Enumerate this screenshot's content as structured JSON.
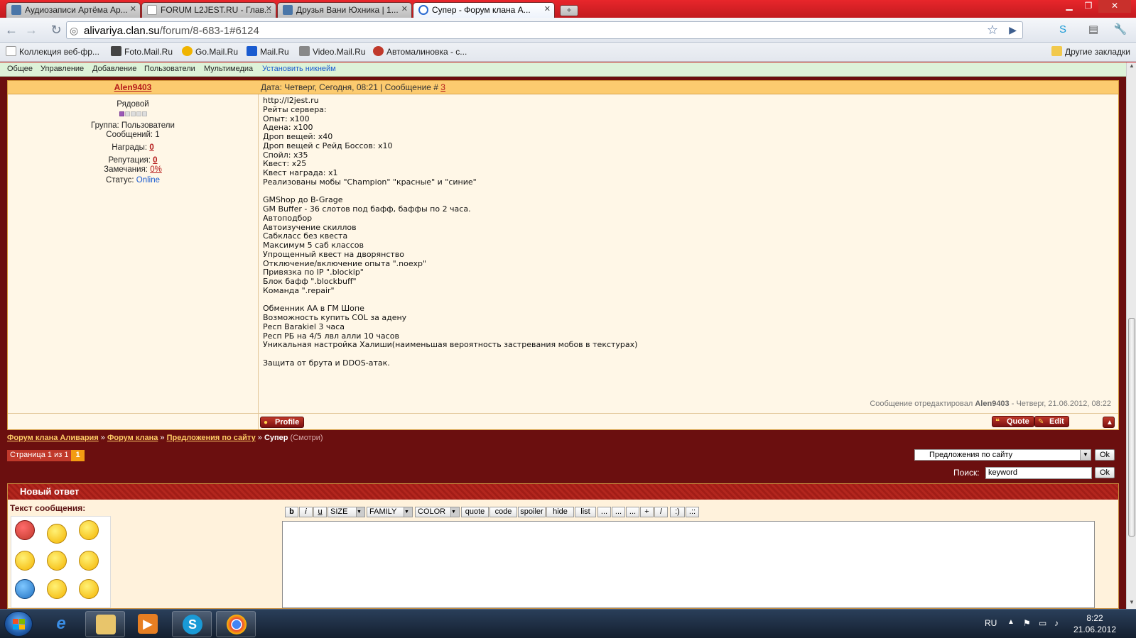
{
  "browser": {
    "tabs": [
      {
        "title": "Аудиозаписи Артёма Ар...",
        "icon": "vk-icon"
      },
      {
        "title": "FORUM L2JEST.RU - Глав...",
        "icon": "page-icon"
      },
      {
        "title": "Друзья Вани Юхника | 1...",
        "icon": "vk-icon"
      },
      {
        "title": "Супер - Форум клана А...",
        "icon": "forum-icon"
      }
    ],
    "url_host": "alivariya.clan.su",
    "url_path": "/forum/8-683-1#6124",
    "bookmarks": [
      {
        "label": "Коллекция веб-фр...",
        "icon": "page-icon"
      },
      {
        "label": "Foto.Mail.Ru",
        "icon": "camera-icon"
      },
      {
        "label": "Go.Mail.Ru",
        "icon": "search-icon"
      },
      {
        "label": "Mail.Ru",
        "icon": "mail-icon"
      },
      {
        "label": "Video.Mail.Ru",
        "icon": "video-icon"
      },
      {
        "label": "Автомалиновка - с...",
        "icon": "car-icon"
      }
    ],
    "other_bookmarks": "Другие закладки"
  },
  "adminbar": {
    "items": [
      "Общее",
      "Управление",
      "Добавление",
      "Пользователи",
      "Мультимедиа"
    ],
    "set_nick": "Установить никнейм"
  },
  "post": {
    "author": "Alen9403",
    "date_prefix": "Дата: Четверг, Сегодня, 08:21 | Сообщение # ",
    "post_number": "3",
    "rank": "Рядовой",
    "group": "Группа: Пользователи",
    "messages": "Сообщений: 1",
    "awards_label": "Награды: ",
    "awards_value": "0",
    "reputation_label": "Репутация: ",
    "reputation_value": "0",
    "warnings_label": "Замечания: ",
    "warnings_value": "0%",
    "status_label": "Статус: ",
    "status_value": "Online",
    "body": "http://l2jest.ru\nРейты сервера:\nОпыт: x100\nАдена: x100\nДроп вещей: x40\nДроп вещей с Рейд Боссов: x10\nСпойл: x35\nКвест: x25\nКвест награда: x1\nРеализованы мобы \"Champion\" \"красные\" и \"синие\"\n\nGMShop до B-Grage\nGM Buffer - 36 слотов под бафф, баффы по 2 часа.\nАвтоподбор\nАвтоизучение скиллов\nСабкласс без квеста\nМаксимум 5 саб классов\nУпрощенный квест на дворянство\nОтключение/включение опыта \".noexp\"\nПривязка по IP \".blockip\"\nБлок бафф \".blockbuff\"\nКоманда \".repair\"\n\nОбменник АА в ГМ Шопе\nВозможность купить COL за адену\nРесп Barakiel 3 часа\nРесп РБ на 4/5 лвл алли 10 часов\nУникальная настройка Халиши(наименьшая вероятность застревания мобов в текстурах)\n\nЗащита от брута и DDOS-атак.",
    "edited_prefix": "Сообщение отредактировал ",
    "edited_user": "Alen9403",
    "edited_suffix": " - Четверг, 21.06.2012, 08:22",
    "profile_btn": "Profile",
    "quote_btn": "Quote",
    "edit_btn": "Edit"
  },
  "breadcrumb": {
    "items": [
      "Форум клана Аливария",
      "Форум клана",
      "Предложения по сайту"
    ],
    "sep": " » ",
    "current": "Супер",
    "current_sub": " (Смотри)"
  },
  "pager": {
    "label": "Страница 1 из 1",
    "current": "1"
  },
  "jump": {
    "selected": "Предложения по сайту",
    "ok": "Ok"
  },
  "search": {
    "label": "Поиск:",
    "value": "keyword",
    "ok": "Ok"
  },
  "reply": {
    "title": "Новый ответ",
    "text_label": "Текст сообщения:",
    "toolbar": [
      "b",
      "i",
      "u",
      "SIZE",
      "FAMILY",
      "COLOR",
      "quote",
      "code",
      "spoiler",
      "hide",
      "list",
      "...",
      "...",
      "...",
      "+",
      "/",
      ":)",
      ".::"
    ]
  },
  "taskbar": {
    "lang": "RU",
    "time": "8:22",
    "date": "21.06.2012"
  },
  "colors": {
    "page_bg": "#6b0f0f",
    "post_header": "#fccb6f",
    "post_body": "#fff7e7",
    "link_red": "#b51a1a",
    "chrome_red": "#c7151b"
  }
}
